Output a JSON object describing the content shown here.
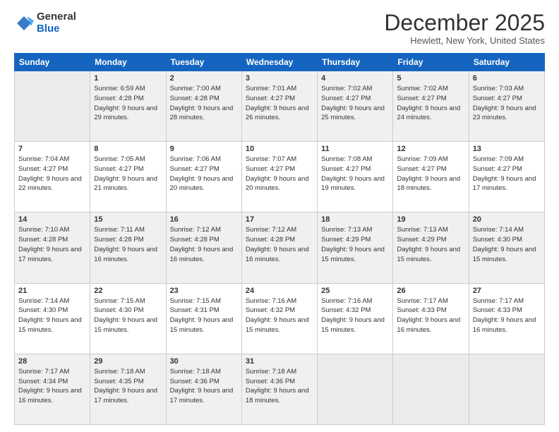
{
  "logo": {
    "general": "General",
    "blue": "Blue"
  },
  "title": "December 2025",
  "location": "Hewlett, New York, United States",
  "days_of_week": [
    "Sunday",
    "Monday",
    "Tuesday",
    "Wednesday",
    "Thursday",
    "Friday",
    "Saturday"
  ],
  "weeks": [
    [
      {
        "day": null,
        "info": null
      },
      {
        "day": "1",
        "sunrise": "6:59 AM",
        "sunset": "4:28 PM",
        "daylight": "9 hours and 29 minutes."
      },
      {
        "day": "2",
        "sunrise": "7:00 AM",
        "sunset": "4:28 PM",
        "daylight": "9 hours and 28 minutes."
      },
      {
        "day": "3",
        "sunrise": "7:01 AM",
        "sunset": "4:27 PM",
        "daylight": "9 hours and 26 minutes."
      },
      {
        "day": "4",
        "sunrise": "7:02 AM",
        "sunset": "4:27 PM",
        "daylight": "9 hours and 25 minutes."
      },
      {
        "day": "5",
        "sunrise": "7:02 AM",
        "sunset": "4:27 PM",
        "daylight": "9 hours and 24 minutes."
      },
      {
        "day": "6",
        "sunrise": "7:03 AM",
        "sunset": "4:27 PM",
        "daylight": "9 hours and 23 minutes."
      }
    ],
    [
      {
        "day": "7",
        "sunrise": "7:04 AM",
        "sunset": "4:27 PM",
        "daylight": "9 hours and 22 minutes."
      },
      {
        "day": "8",
        "sunrise": "7:05 AM",
        "sunset": "4:27 PM",
        "daylight": "9 hours and 21 minutes."
      },
      {
        "day": "9",
        "sunrise": "7:06 AM",
        "sunset": "4:27 PM",
        "daylight": "9 hours and 20 minutes."
      },
      {
        "day": "10",
        "sunrise": "7:07 AM",
        "sunset": "4:27 PM",
        "daylight": "9 hours and 20 minutes."
      },
      {
        "day": "11",
        "sunrise": "7:08 AM",
        "sunset": "4:27 PM",
        "daylight": "9 hours and 19 minutes."
      },
      {
        "day": "12",
        "sunrise": "7:09 AM",
        "sunset": "4:27 PM",
        "daylight": "9 hours and 18 minutes."
      },
      {
        "day": "13",
        "sunrise": "7:09 AM",
        "sunset": "4:27 PM",
        "daylight": "9 hours and 17 minutes."
      }
    ],
    [
      {
        "day": "14",
        "sunrise": "7:10 AM",
        "sunset": "4:28 PM",
        "daylight": "9 hours and 17 minutes."
      },
      {
        "day": "15",
        "sunrise": "7:11 AM",
        "sunset": "4:28 PM",
        "daylight": "9 hours and 16 minutes."
      },
      {
        "day": "16",
        "sunrise": "7:12 AM",
        "sunset": "4:28 PM",
        "daylight": "9 hours and 16 minutes."
      },
      {
        "day": "17",
        "sunrise": "7:12 AM",
        "sunset": "4:28 PM",
        "daylight": "9 hours and 16 minutes."
      },
      {
        "day": "18",
        "sunrise": "7:13 AM",
        "sunset": "4:29 PM",
        "daylight": "9 hours and 15 minutes."
      },
      {
        "day": "19",
        "sunrise": "7:13 AM",
        "sunset": "4:29 PM",
        "daylight": "9 hours and 15 minutes."
      },
      {
        "day": "20",
        "sunrise": "7:14 AM",
        "sunset": "4:30 PM",
        "daylight": "9 hours and 15 minutes."
      }
    ],
    [
      {
        "day": "21",
        "sunrise": "7:14 AM",
        "sunset": "4:30 PM",
        "daylight": "9 hours and 15 minutes."
      },
      {
        "day": "22",
        "sunrise": "7:15 AM",
        "sunset": "4:30 PM",
        "daylight": "9 hours and 15 minutes."
      },
      {
        "day": "23",
        "sunrise": "7:15 AM",
        "sunset": "4:31 PM",
        "daylight": "9 hours and 15 minutes."
      },
      {
        "day": "24",
        "sunrise": "7:16 AM",
        "sunset": "4:32 PM",
        "daylight": "9 hours and 15 minutes."
      },
      {
        "day": "25",
        "sunrise": "7:16 AM",
        "sunset": "4:32 PM",
        "daylight": "9 hours and 15 minutes."
      },
      {
        "day": "26",
        "sunrise": "7:17 AM",
        "sunset": "4:33 PM",
        "daylight": "9 hours and 16 minutes."
      },
      {
        "day": "27",
        "sunrise": "7:17 AM",
        "sunset": "4:33 PM",
        "daylight": "9 hours and 16 minutes."
      }
    ],
    [
      {
        "day": "28",
        "sunrise": "7:17 AM",
        "sunset": "4:34 PM",
        "daylight": "9 hours and 16 minutes."
      },
      {
        "day": "29",
        "sunrise": "7:18 AM",
        "sunset": "4:35 PM",
        "daylight": "9 hours and 17 minutes."
      },
      {
        "day": "30",
        "sunrise": "7:18 AM",
        "sunset": "4:36 PM",
        "daylight": "9 hours and 17 minutes."
      },
      {
        "day": "31",
        "sunrise": "7:18 AM",
        "sunset": "4:36 PM",
        "daylight": "9 hours and 18 minutes."
      },
      {
        "day": null,
        "info": null
      },
      {
        "day": null,
        "info": null
      },
      {
        "day": null,
        "info": null
      }
    ]
  ]
}
